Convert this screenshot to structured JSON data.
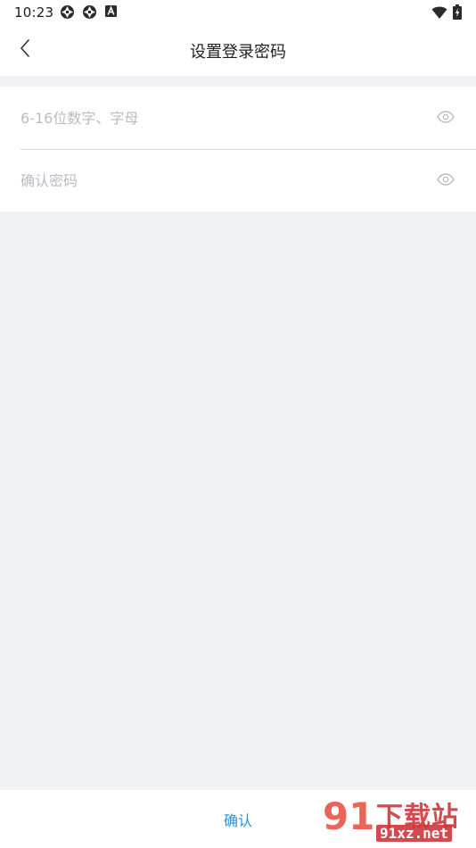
{
  "status_bar": {
    "time": "10:23",
    "left_icons": [
      "aperture-icon",
      "aperture-icon",
      "a-box-icon"
    ],
    "right_icons": [
      "wifi-icon",
      "battery-charging-icon"
    ]
  },
  "header": {
    "title": "设置登录密码",
    "back_icon": "chevron-left-icon"
  },
  "form": {
    "password_placeholder": "6-16位数字、字母",
    "password_value": "",
    "confirm_placeholder": "确认密码",
    "confirm_value": "",
    "eye_icon": "eye-icon"
  },
  "footer": {
    "confirm_label": "确认"
  },
  "watermark": {
    "number": "91",
    "title": "下载站",
    "url": "91xz.net"
  },
  "colors": {
    "accent": "#2a8fe0",
    "background": "#f2f3f7",
    "surface": "#ffffff",
    "placeholder": "#b9bcc4",
    "divider": "#d9d9d9"
  }
}
